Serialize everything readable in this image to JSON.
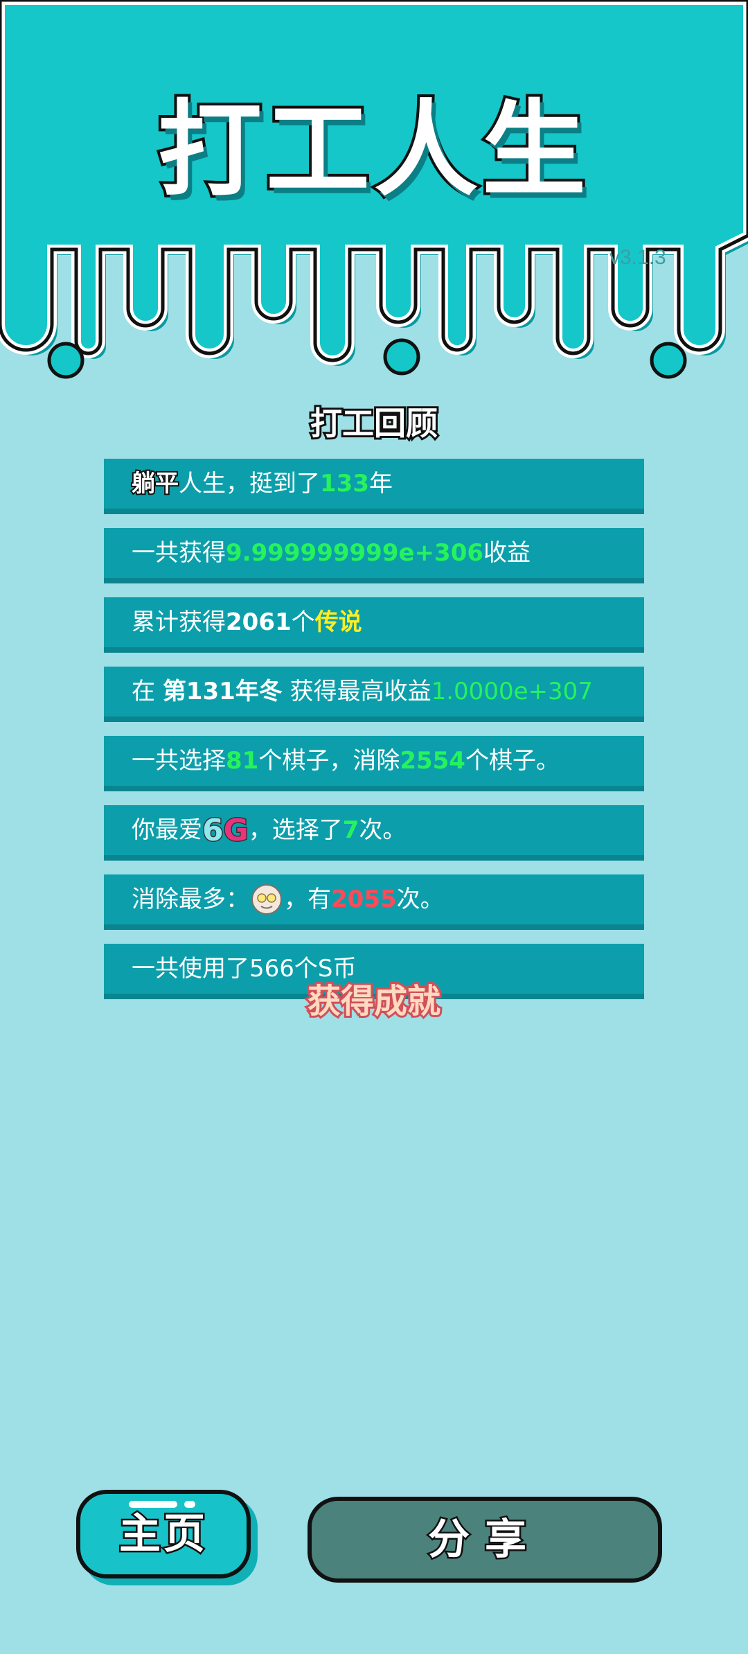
{
  "header": {
    "title": "打工人生",
    "version": "v3.1.3",
    "colors": {
      "top": "#15c7c9",
      "drip_outline": "#111111",
      "drip_inner": "#ffffff"
    }
  },
  "review": {
    "title": "打工回顾",
    "rows": [
      {
        "parts": [
          {
            "t": "躺平",
            "style": "tangping"
          },
          {
            "t": "人生，挺到了"
          },
          {
            "t": "133",
            "style": "g"
          },
          {
            "t": "年"
          }
        ]
      },
      {
        "parts": [
          {
            "t": "一共获得"
          },
          {
            "t": "9.999999999e+306",
            "style": "g"
          },
          {
            "t": "收益"
          }
        ]
      },
      {
        "parts": [
          {
            "t": "累计获得"
          },
          {
            "t": "2061",
            "style": "b"
          },
          {
            "t": "个"
          },
          {
            "t": "传说",
            "style": "y"
          }
        ]
      },
      {
        "parts": [
          {
            "t": "在 "
          },
          {
            "t": "第131年冬",
            "style": "b"
          },
          {
            "t": " 获得最高收益"
          },
          {
            "t": "1.0000e+307",
            "style": "gl"
          }
        ]
      },
      {
        "parts": [
          {
            "t": "一共选择"
          },
          {
            "t": "81",
            "style": "g"
          },
          {
            "t": "个棋子，消除"
          },
          {
            "t": "2554",
            "style": "g"
          },
          {
            "t": "个棋子。"
          }
        ]
      },
      {
        "parts": [
          {
            "t": "你最爱"
          },
          {
            "t": "6G",
            "style": "badge6g"
          },
          {
            "t": "，选择了"
          },
          {
            "t": "7",
            "style": "g"
          },
          {
            "t": "次。"
          }
        ]
      },
      {
        "parts": [
          {
            "t": "消除最多："
          },
          {
            "t": "old-man-avatar",
            "style": "avatar"
          },
          {
            "t": "，有"
          },
          {
            "t": "2055",
            "style": "r"
          },
          {
            "t": "次。"
          }
        ]
      },
      {
        "parts": [
          {
            "t": "一共使用了566个S币"
          }
        ]
      }
    ]
  },
  "achievements": {
    "title": "获得成就"
  },
  "buttons": {
    "home": "主页",
    "share": "分享"
  }
}
